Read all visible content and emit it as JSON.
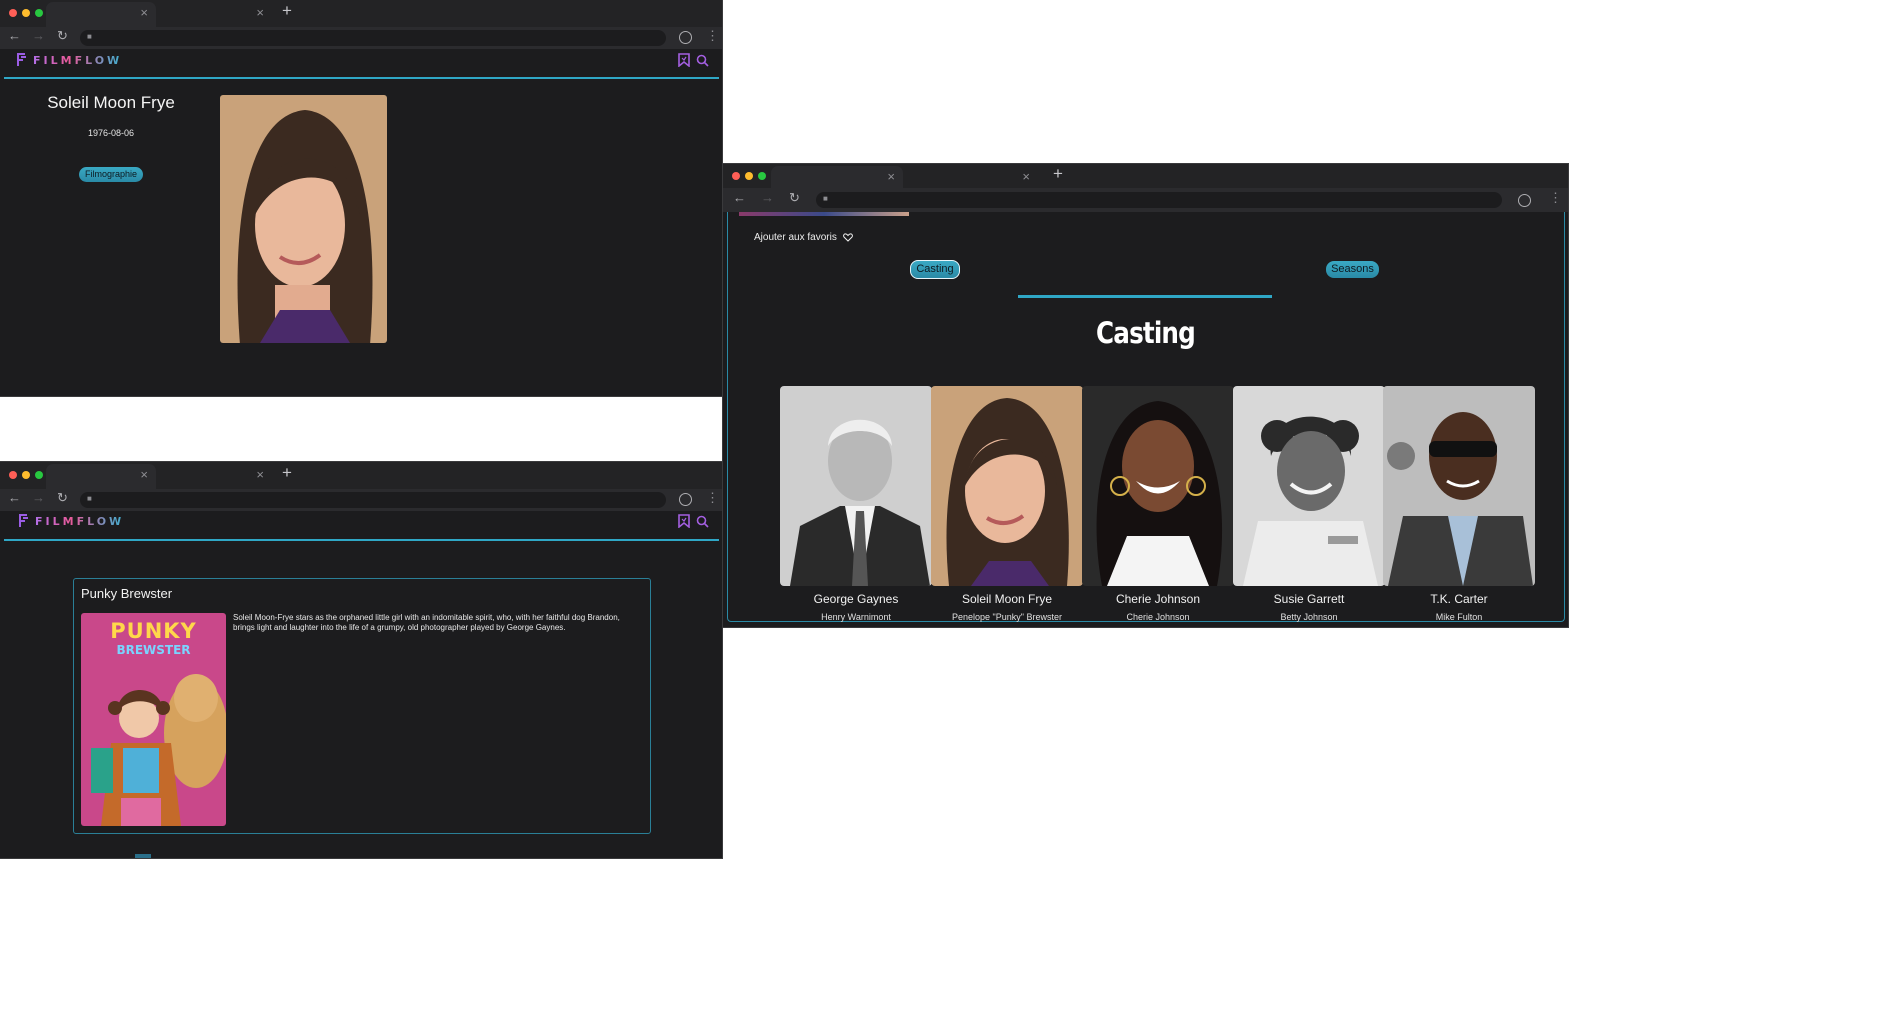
{
  "brand": {
    "name": "FILMFLOW"
  },
  "actor_page": {
    "name": "Soleil Moon Frye",
    "birthdate": "1976-08-06",
    "filmography_button": "Filmographie"
  },
  "show_page": {
    "title": "Punky Brewster",
    "poster_title_line1": "PUNKY",
    "poster_title_line2": "BREWSTER",
    "description": "Soleil Moon-Frye stars as the orphaned little girl with an indomitable spirit, who, with her faithful dog Brandon, brings light and laughter into the life of a grumpy, old photographer played by George Gaynes."
  },
  "cast_page": {
    "favorite_label": "Ajouter aux favoris",
    "tabs": [
      {
        "label": "Casting",
        "active": true
      },
      {
        "label": "Seasons",
        "active": false
      }
    ],
    "heading": "Casting",
    "cast": [
      {
        "name": "George Gaynes",
        "role": "Henry Warnimont"
      },
      {
        "name": "Soleil Moon Frye",
        "role": "Penelope \"Punky\" Brewster"
      },
      {
        "name": "Cherie Johnson",
        "role": "Cherie Johnson"
      },
      {
        "name": "Susie Garrett",
        "role": "Betty Johnson"
      },
      {
        "name": "T.K. Carter",
        "role": "Mike Fulton"
      }
    ]
  },
  "colors": {
    "accent": "#2fa7c6",
    "background": "#1c1c1e",
    "logo_purple": "#9b5de5"
  }
}
